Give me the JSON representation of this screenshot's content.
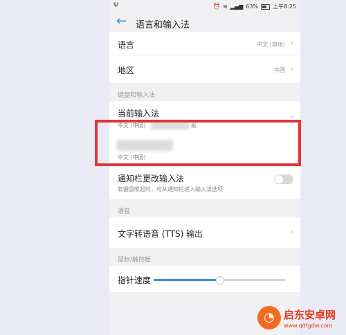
{
  "statusbar": {
    "battery": "63%",
    "time": "上午8:25"
  },
  "header": {
    "title": "语言和输入法"
  },
  "language_row": {
    "label": "语言",
    "value": "中文 (简体)"
  },
  "region_row": {
    "label": "地区",
    "value": "中国"
  },
  "section_keyboard": "键盘和输入法",
  "current_ime": {
    "label": "当前输入法",
    "sub": "中文 (中国)",
    "trailing": "板"
  },
  "ime2": {
    "sub": "中文 (中国)"
  },
  "notify_ime": {
    "label": "通知栏更改输入法",
    "sub": "软键盘唤起时，可从通知栏进入输入法选项",
    "enabled": false
  },
  "section_voice": "语音",
  "tts_row": {
    "label": "文字转语音 (TTS) 输出"
  },
  "section_pointer": "鼠标/触控板",
  "pointer_speed": {
    "label": "指针速度",
    "level": 0.5
  },
  "watermark": {
    "name": "启东安卓网",
    "url": "www.qdtgdw.com"
  },
  "colors": {
    "accent": "#3a91dc",
    "highlight": "#e0353c"
  }
}
